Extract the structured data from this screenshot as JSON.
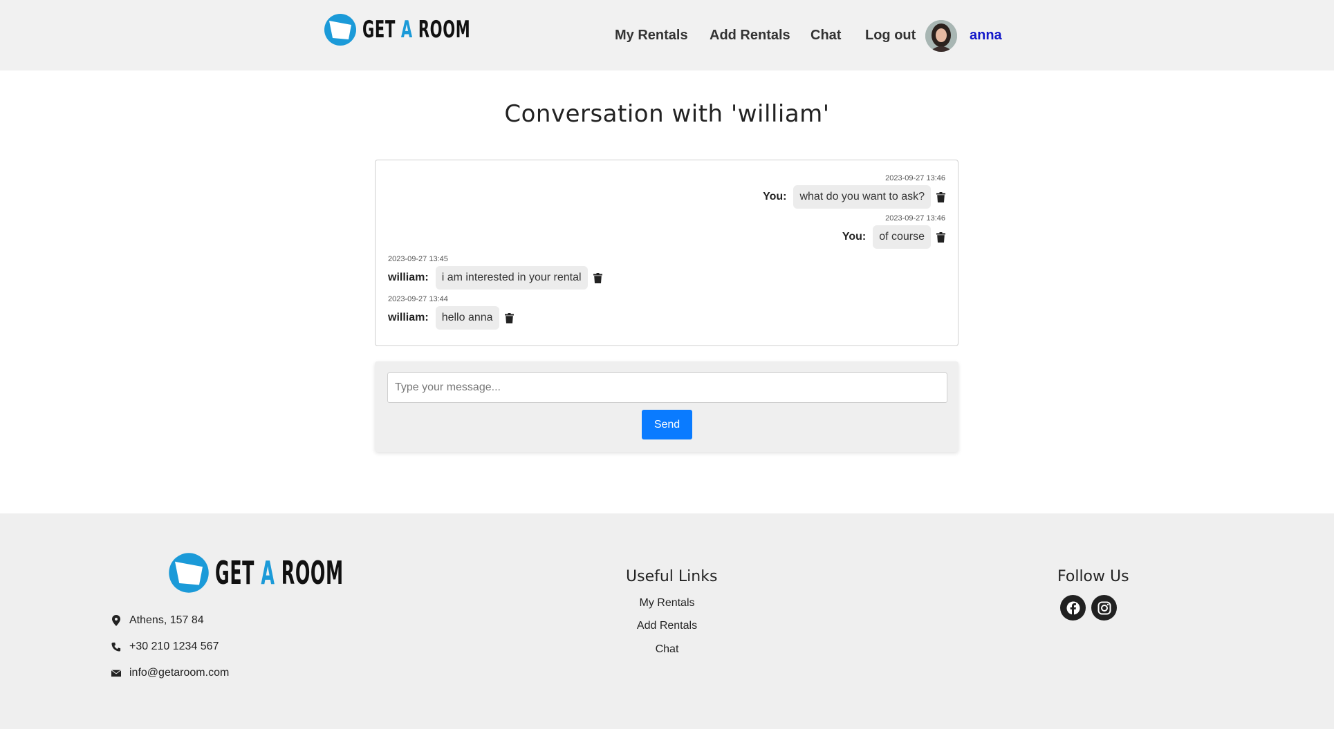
{
  "header": {
    "logo_prefix": "GET",
    "logo_a": "A",
    "logo_suffix": "ROOM",
    "nav": [
      "My Rentals",
      "Add Rentals",
      "Chat",
      "Log out"
    ],
    "username": "anna",
    "brand_color": "#1b9ad8",
    "username_color": "#1318c9"
  },
  "main": {
    "title": "Conversation with 'william'",
    "messages": [
      {
        "time": "2023-09-27 13:46",
        "sender": "You:",
        "text": "what do you want to ask?",
        "side": "right"
      },
      {
        "time": "2023-09-27 13:46",
        "sender": "You:",
        "text": "of course",
        "side": "right"
      },
      {
        "time": "2023-09-27 13:45",
        "sender": "william:",
        "text": "i am interested in your rental",
        "side": "left"
      },
      {
        "time": "2023-09-27 13:44",
        "sender": "william:",
        "text": "hello anna",
        "side": "left"
      }
    ],
    "input_placeholder": "Type your message...",
    "send_label": "Send",
    "send_color": "#0a7bff",
    "icons": [
      "trash-icon"
    ]
  },
  "footer": {
    "contact": [
      {
        "icon": "location-pin-icon",
        "text": "Athens, 157 84"
      },
      {
        "icon": "phone-icon",
        "text": "+30 210 1234 567"
      },
      {
        "icon": "envelope-icon",
        "text": "info@getaroom.com"
      }
    ],
    "useful_links_heading": "Useful Links",
    "useful_links": [
      "My Rentals",
      "Add Rentals",
      "Chat"
    ],
    "follow_heading": "Follow Us",
    "social": [
      "facebook-icon",
      "instagram-icon"
    ]
  }
}
